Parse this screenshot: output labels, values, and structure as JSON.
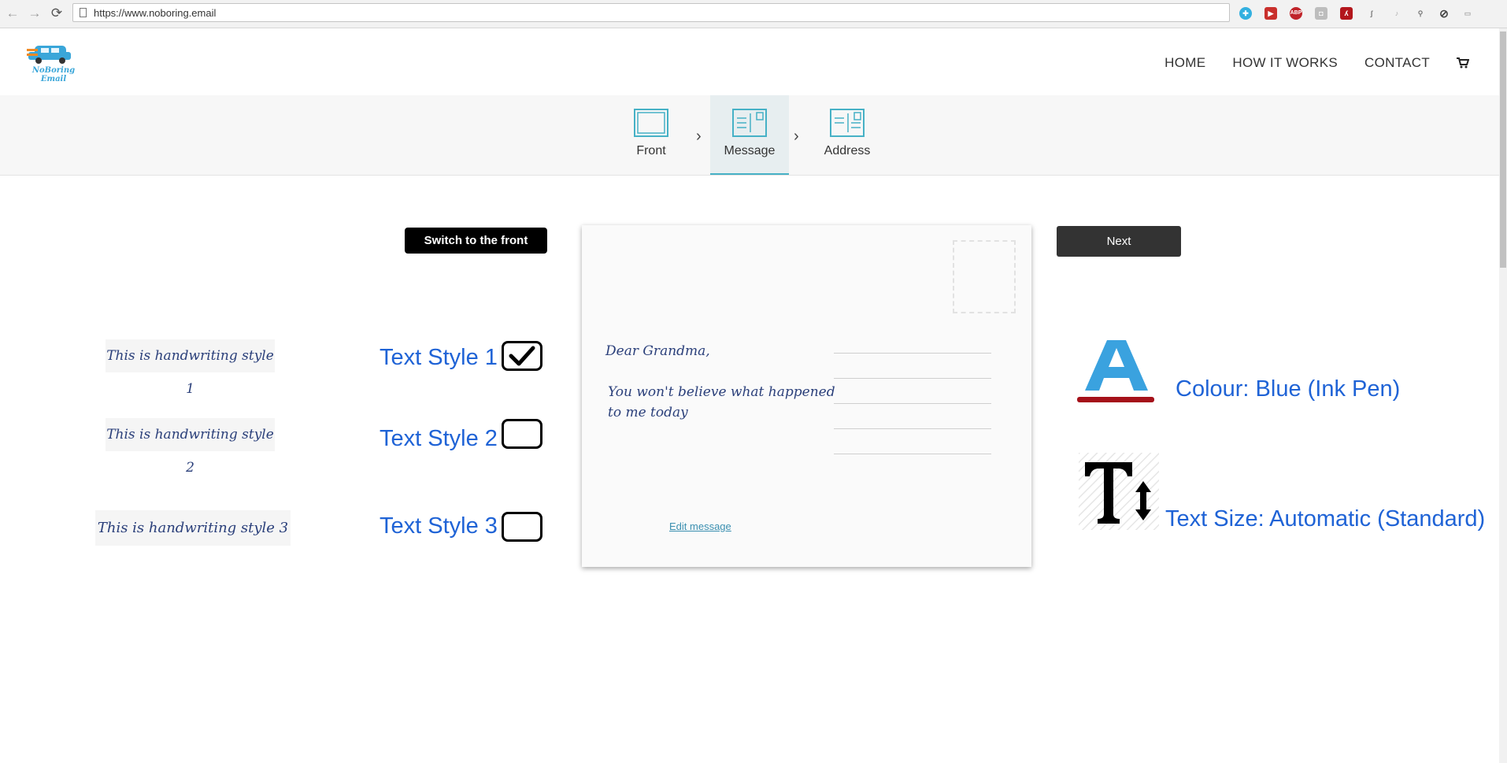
{
  "browser": {
    "url": "https://www.noboring.email",
    "extensions": [
      "share-ext-icon",
      "ext-icon",
      "adblock-icon",
      "camera-icon",
      "pdf-icon",
      "ext-icon",
      "ext-icon",
      "search-ext-icon",
      "block-icon",
      "ext-icon"
    ]
  },
  "site": {
    "logo_text": "NoBoring Email",
    "nav": [
      "HOME",
      "HOW IT WORKS",
      "CONTACT"
    ],
    "steps": [
      {
        "label": "Front",
        "icon": "front-card-icon"
      },
      {
        "label": "Message",
        "icon": "message-card-icon"
      },
      {
        "label": "Address",
        "icon": "address-card-icon"
      }
    ],
    "active_step": "Message"
  },
  "editor": {
    "switch_button": "Switch to the front",
    "next_button": "Next",
    "handwriting_samples": [
      "This is handwriting style 1",
      "This is handwriting style 2",
      "This is handwriting style 3"
    ],
    "text_styles": [
      {
        "label": "Text Style 1",
        "checked": true
      },
      {
        "label": "Text Style 2",
        "checked": false
      },
      {
        "label": "Text Style 3",
        "checked": false
      }
    ],
    "postcard": {
      "greeting": "Dear Grandma,",
      "body_line1": "You won't believe what happened",
      "body_line2": "to me today",
      "edit_link": "Edit message"
    },
    "colour": "Colour: Blue (Ink Pen)",
    "text_size": "Text Size: Automatic (Standard)"
  },
  "colors": {
    "accent": "#46b1c6",
    "label_blue": "#1f63d6",
    "ink": "#2a3f7a",
    "colour_swatch": "#3aa2df",
    "underline_red": "#a5111a"
  }
}
